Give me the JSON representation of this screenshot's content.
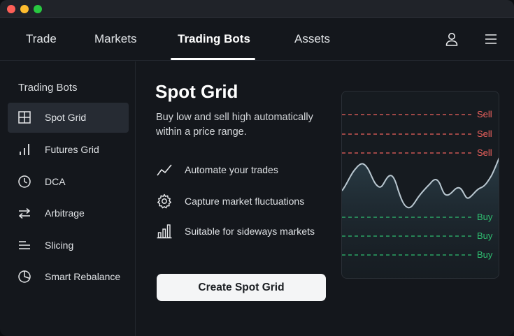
{
  "nav": {
    "tabs": [
      {
        "label": "Trade"
      },
      {
        "label": "Markets"
      },
      {
        "label": "Trading Bots",
        "active": true
      },
      {
        "label": "Assets"
      }
    ],
    "icons": [
      "user-icon",
      "hamburger-menu-icon"
    ]
  },
  "sidebar": {
    "title": "Trading Bots",
    "items": [
      {
        "label": "Spot Grid",
        "icon": "grid-icon",
        "active": true
      },
      {
        "label": "Futures Grid",
        "icon": "bar-signal-icon"
      },
      {
        "label": "DCA",
        "icon": "clock-icon"
      },
      {
        "label": "Arbitrage",
        "icon": "swap-arrows-icon"
      },
      {
        "label": "Slicing",
        "icon": "slicing-lines-icon"
      },
      {
        "label": "Smart Rebalance",
        "icon": "pie-chart-icon"
      }
    ]
  },
  "main": {
    "title": "Spot Grid",
    "description": "Buy low and sell high automatically within a price range.",
    "features": [
      {
        "label": "Automate your trades",
        "icon": "trend-line-icon"
      },
      {
        "label": "Capture market fluctuations",
        "icon": "gear-icon"
      },
      {
        "label": "Suitable for sideways markets",
        "icon": "bar-chart-icon"
      }
    ],
    "cta_label": "Create Spot Grid"
  },
  "grid_chart": {
    "sell_label": "Sell",
    "buy_label": "Buy",
    "sell_color": "#f0625e",
    "buy_color": "#2fbf71",
    "line_color": "#b9c7d0"
  }
}
